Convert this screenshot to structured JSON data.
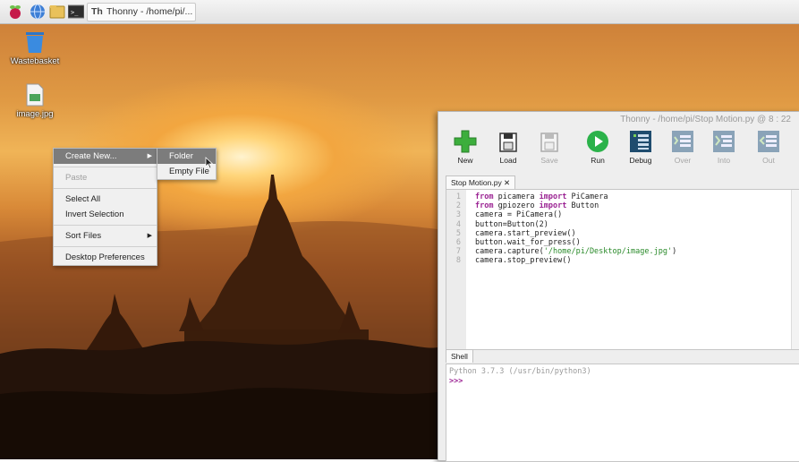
{
  "taskbar": {
    "launchers": [
      "raspberry-menu-icon",
      "web-browser-icon",
      "file-manager-icon",
      "terminal-icon"
    ],
    "window_button": {
      "icon_text": "Th",
      "label": "Thonny  -  /home/pi/..."
    }
  },
  "desktop": {
    "icons": [
      {
        "label": "Wastebasket"
      },
      {
        "label": "image.jpg"
      }
    ]
  },
  "context_menu": {
    "items": [
      {
        "label": "Create New...",
        "selected": true,
        "submenu": true
      },
      {
        "label": "Paste",
        "disabled": true
      },
      {
        "label": "Select All"
      },
      {
        "label": "Invert Selection"
      },
      {
        "label": "Sort Files",
        "submenu": true
      },
      {
        "label": "Desktop Preferences"
      }
    ],
    "submenu_items": [
      {
        "label": "Folder",
        "selected": true
      },
      {
        "label": "Empty File"
      }
    ]
  },
  "thonny": {
    "title": "Thonny  -  /home/pi/Stop Motion.py  @  8 : 22",
    "toolbar": {
      "new": "New",
      "load": "Load",
      "save": "Save",
      "run": "Run",
      "debug": "Debug",
      "over": "Over",
      "into": "Into",
      "out": "Out"
    },
    "editor_tab": "Stop Motion.py ✕",
    "line_numbers": [
      "1",
      "2",
      "3",
      "4",
      "5",
      "6",
      "7",
      "8"
    ],
    "code": [
      [
        {
          "t": "from",
          "k": "kw"
        },
        {
          "t": " picamera "
        },
        {
          "t": "import",
          "k": "kw"
        },
        {
          "t": " PiCamera"
        }
      ],
      [
        {
          "t": "from",
          "k": "kw"
        },
        {
          "t": " gpiozero "
        },
        {
          "t": "import",
          "k": "kw"
        },
        {
          "t": " Button"
        }
      ],
      [
        {
          "t": "camera = PiCamera()"
        }
      ],
      [
        {
          "t": "button=Button(2)"
        }
      ],
      [
        {
          "t": "camera.start_preview()"
        }
      ],
      [
        {
          "t": "button.wait_for_press()"
        }
      ],
      [
        {
          "t": "camera.capture("
        },
        {
          "t": "'/home/pi/Desktop/image.jpg'",
          "k": "str"
        },
        {
          "t": ")"
        }
      ],
      [
        {
          "t": "camera.stop_preview()"
        }
      ]
    ],
    "shell_tab": "Shell",
    "shell_banner": "Python 3.7.3 (/usr/bin/python3)",
    "shell_prompt": ">>>"
  }
}
